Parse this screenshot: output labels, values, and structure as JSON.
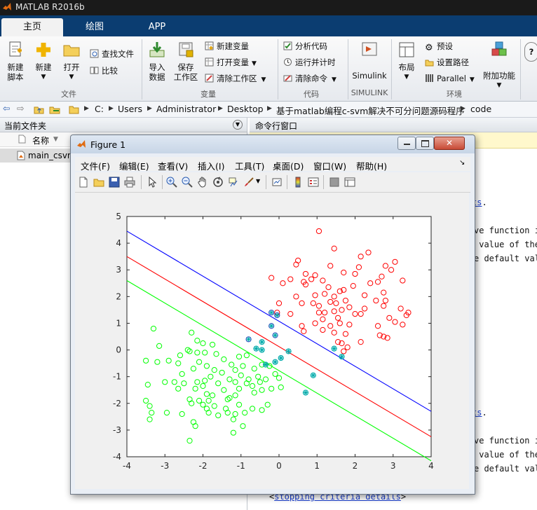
{
  "app": {
    "title": "MATLAB R2016b"
  },
  "ribbon_tabs": [
    {
      "label": "主页",
      "active": true
    },
    {
      "label": "绘图",
      "active": false
    },
    {
      "label": "APP",
      "active": false
    }
  ],
  "ribbon": {
    "file_group": "文件",
    "variable_group": "变量",
    "code_group": "代码",
    "simulink_group": "SIMULINK",
    "env_group": "环境",
    "new_script": "新建\n脚本",
    "new": "新建",
    "open": "打开",
    "find_files": "查找文件",
    "compare": "比较",
    "import_data": "导入\n数据",
    "save_workspace": "保存\n工作区",
    "new_variable": "新建变量",
    "open_variable": "打开变量",
    "clear_workspace": "清除工作区",
    "analyze_code": "分析代码",
    "run_and_time": "运行并计时",
    "clear_commands": "清除命令",
    "simulink": "Simulink",
    "layout": "布局",
    "preferences": "预设",
    "set_path": "设置路径",
    "parallel": "Parallel",
    "addons": "附加功能"
  },
  "address": {
    "crumbs": [
      "C:",
      "Users",
      "Administrator",
      "Desktop",
      "基于matlab编程c-svm解决不可分问题源码程序",
      "code"
    ]
  },
  "current_folder": {
    "title": "当前文件夹",
    "column_name": "名称",
    "files": [
      "main_csvm"
    ]
  },
  "command_window": {
    "title": "命令行窗口",
    "lines_top": [
      {
        "pre": "",
        "link": "ts",
        "post": "."
      },
      {
        "pre": "ve function i",
        "link": "",
        "post": ""
      },
      {
        "pre": " value of the",
        "link": "",
        "post": ""
      },
      {
        "pre": "e default val",
        "link": "",
        "post": ""
      }
    ],
    "lines_bottom": [
      {
        "pre": "",
        "link": "ts",
        "post": "."
      },
      {
        "pre": "ve function i",
        "link": "",
        "post": ""
      },
      {
        "pre": " value of the",
        "link": "",
        "post": ""
      },
      {
        "pre": "e default val",
        "link": "",
        "post": ""
      }
    ],
    "stop_open": "<",
    "stop_link": "stopping criteria details",
    "stop_close": ">"
  },
  "figure": {
    "title": "Figure 1",
    "menu": [
      "文件(F)",
      "编辑(E)",
      "查看(V)",
      "插入(I)",
      "工具(T)",
      "桌面(D)",
      "窗口(W)",
      "帮助(H)"
    ]
  },
  "colors": {
    "class_pos": "#ff0000",
    "class_neg": "#00ff00",
    "sv_marker": "#00aaaa",
    "boundary": "#ff0000",
    "margin_upper": "#0000ff",
    "margin_lower": "#00ff00"
  },
  "chart_data": {
    "type": "scatter",
    "title": "",
    "xlabel": "",
    "ylabel": "",
    "xlim": [
      -4,
      4
    ],
    "ylim": [
      -4,
      5
    ],
    "xticks": [
      -4,
      -3,
      -2,
      -1,
      0,
      1,
      2,
      3,
      4
    ],
    "yticks": [
      -4,
      -3,
      -2,
      -1,
      0,
      1,
      2,
      3,
      4,
      5
    ],
    "grid": false,
    "legend": "none",
    "lines": [
      {
        "role": "upper-margin",
        "color": "#0000ff",
        "x": [
          -4,
          4
        ],
        "y": [
          4.45,
          -2.3
        ]
      },
      {
        "role": "decision-boundary",
        "color": "#ff0000",
        "x": [
          -4,
          4
        ],
        "y": [
          3.5,
          -3.25
        ]
      },
      {
        "role": "lower-margin",
        "color": "#00ff00",
        "x": [
          -4,
          4
        ],
        "y": [
          2.6,
          -4.15
        ]
      }
    ],
    "series": [
      {
        "class": "positive",
        "marker": "o",
        "color": "#ff0000",
        "points": [
          [
            1.05,
            4.45
          ],
          [
            1.45,
            3.8
          ],
          [
            2.35,
            3.65
          ],
          [
            2.15,
            3.5
          ],
          [
            0.5,
            3.35
          ],
          [
            0.45,
            3.2
          ],
          [
            1.35,
            3.15
          ],
          [
            2.1,
            3.1
          ],
          [
            2.8,
            3.15
          ],
          [
            3.05,
            3.3
          ],
          [
            2.95,
            3.0
          ],
          [
            0.7,
            2.85
          ],
          [
            1.7,
            2.9
          ],
          [
            0.95,
            2.8
          ],
          [
            2.0,
            2.85
          ],
          [
            2.7,
            2.75
          ],
          [
            0.85,
            2.65
          ],
          [
            0.65,
            2.55
          ],
          [
            0.3,
            2.65
          ],
          [
            1.15,
            2.6
          ],
          [
            2.4,
            2.5
          ],
          [
            -0.2,
            2.7
          ],
          [
            0.1,
            2.5
          ],
          [
            0.7,
            2.45
          ],
          [
            1.3,
            2.35
          ],
          [
            1.95,
            2.4
          ],
          [
            2.6,
            2.55
          ],
          [
            3.25,
            2.6
          ],
          [
            1.2,
            2.1
          ],
          [
            1.6,
            2.2
          ],
          [
            1.7,
            2.25
          ],
          [
            2.25,
            2.05
          ],
          [
            2.75,
            2.15
          ],
          [
            0.45,
            2.0
          ],
          [
            0.95,
            2.05
          ],
          [
            1.45,
            2.0
          ],
          [
            0.0,
            1.75
          ],
          [
            0.6,
            1.75
          ],
          [
            0.9,
            1.75
          ],
          [
            1.35,
            1.8
          ],
          [
            1.5,
            1.75
          ],
          [
            1.75,
            1.85
          ],
          [
            2.55,
            1.85
          ],
          [
            2.8,
            1.85
          ],
          [
            -0.05,
            1.4
          ],
          [
            1.05,
            1.65
          ],
          [
            1.85,
            1.6
          ],
          [
            2.25,
            1.55
          ],
          [
            2.75,
            1.65
          ],
          [
            0.3,
            1.35
          ],
          [
            1.05,
            1.4
          ],
          [
            1.2,
            1.4
          ],
          [
            1.45,
            1.45
          ],
          [
            1.65,
            1.5
          ],
          [
            2.0,
            1.35
          ],
          [
            3.2,
            1.55
          ],
          [
            3.4,
            1.4
          ],
          [
            3.35,
            1.3
          ],
          [
            1.15,
            1.15
          ],
          [
            1.55,
            1.2
          ],
          [
            2.15,
            1.35
          ],
          [
            2.9,
            1.2
          ],
          [
            3.05,
            1.05
          ],
          [
            3.25,
            0.95
          ],
          [
            0.95,
            1.0
          ],
          [
            1.35,
            0.9
          ],
          [
            1.6,
            1.0
          ],
          [
            1.85,
            0.95
          ],
          [
            2.6,
            0.9
          ],
          [
            0.65,
            0.7
          ],
          [
            1.15,
            0.75
          ],
          [
            1.45,
            0.65
          ],
          [
            1.75,
            0.6
          ],
          [
            2.65,
            0.55
          ],
          [
            2.75,
            0.5
          ],
          [
            2.85,
            0.45
          ],
          [
            1.55,
            0.3
          ],
          [
            2.15,
            0.3
          ],
          [
            1.8,
            0.1
          ],
          [
            1.7,
            -0.05
          ],
          [
            0.6,
            0.9
          ],
          [
            1.65,
            0.25
          ]
        ]
      },
      {
        "class": "negative",
        "marker": "o",
        "color": "#00ff00",
        "points": [
          [
            -3.3,
            0.8
          ],
          [
            -2.3,
            0.65
          ],
          [
            -3.15,
            0.15
          ],
          [
            -2.15,
            0.35
          ],
          [
            -2.0,
            0.25
          ],
          [
            -1.75,
            0.2
          ],
          [
            -2.4,
            0.0
          ],
          [
            -2.35,
            -0.05
          ],
          [
            -2.15,
            -0.1
          ],
          [
            -1.95,
            -0.1
          ],
          [
            -1.65,
            -0.15
          ],
          [
            -1.45,
            -0.35
          ],
          [
            -1.05,
            -0.25
          ],
          [
            -0.85,
            -0.2
          ],
          [
            -2.6,
            -0.2
          ],
          [
            -2.9,
            -0.4
          ],
          [
            -3.2,
            -0.45
          ],
          [
            -3.5,
            -0.4
          ],
          [
            -2.65,
            -0.5
          ],
          [
            -2.1,
            -0.45
          ],
          [
            -1.9,
            -0.6
          ],
          [
            -1.7,
            -0.75
          ],
          [
            -1.25,
            -0.55
          ],
          [
            -1.15,
            -0.75
          ],
          [
            -0.95,
            -0.6
          ],
          [
            -0.65,
            -0.7
          ],
          [
            -0.45,
            -0.55
          ],
          [
            -0.25,
            -0.6
          ],
          [
            -2.25,
            -0.7
          ],
          [
            -2.55,
            -0.9
          ],
          [
            -1.5,
            -0.85
          ],
          [
            -1.0,
            -0.95
          ],
          [
            -0.55,
            -1.0
          ],
          [
            -0.1,
            -0.9
          ],
          [
            -1.8,
            -1.0
          ],
          [
            -1.3,
            -1.1
          ],
          [
            -0.8,
            -1.1
          ],
          [
            -0.35,
            -1.1
          ],
          [
            0.0,
            -1.05
          ],
          [
            -3.0,
            -1.2
          ],
          [
            -2.75,
            -1.2
          ],
          [
            -2.5,
            -1.25
          ],
          [
            -2.15,
            -1.2
          ],
          [
            -1.95,
            -1.15
          ],
          [
            -1.6,
            -1.25
          ],
          [
            -1.15,
            -1.2
          ],
          [
            -0.85,
            -1.25
          ],
          [
            -0.5,
            -1.2
          ],
          [
            -2.0,
            -1.35
          ],
          [
            -3.45,
            -1.3
          ],
          [
            -2.65,
            -1.45
          ],
          [
            -2.2,
            -1.45
          ],
          [
            -0.7,
            -1.35
          ],
          [
            -1.45,
            -1.5
          ],
          [
            -1.05,
            -1.45
          ],
          [
            -0.65,
            -1.6
          ],
          [
            -0.45,
            -1.5
          ],
          [
            -0.2,
            -1.45
          ],
          [
            -1.9,
            -1.65
          ],
          [
            -1.75,
            -1.7
          ],
          [
            -1.3,
            -1.8
          ],
          [
            -1.15,
            -1.7
          ],
          [
            0.05,
            -1.4
          ],
          [
            -2.35,
            -1.85
          ],
          [
            -2.1,
            -1.9
          ],
          [
            -1.85,
            -1.9
          ],
          [
            -1.35,
            -1.85
          ],
          [
            -3.5,
            -1.9
          ],
          [
            -2.0,
            -2.05
          ],
          [
            -1.7,
            -2.1
          ],
          [
            -1.9,
            -2.2
          ],
          [
            -3.4,
            -2.1
          ],
          [
            -2.3,
            -2.0
          ],
          [
            -1.05,
            -2.05
          ],
          [
            -0.7,
            -2.2
          ],
          [
            -0.45,
            -2.25
          ],
          [
            -0.3,
            -2.05
          ],
          [
            -3.35,
            -2.35
          ],
          [
            -2.95,
            -2.35
          ],
          [
            -2.55,
            -2.4
          ],
          [
            -1.85,
            -2.35
          ],
          [
            -1.4,
            -2.2
          ],
          [
            -1.35,
            -2.35
          ],
          [
            -1.15,
            -2.4
          ],
          [
            -3.4,
            -2.6
          ],
          [
            -2.25,
            -2.7
          ],
          [
            -2.2,
            -2.85
          ],
          [
            -1.2,
            -2.6
          ],
          [
            -0.95,
            -2.85
          ],
          [
            -1.2,
            -3.1
          ],
          [
            -0.9,
            -2.35
          ],
          [
            -2.35,
            -3.4
          ],
          [
            -1.6,
            -2.45
          ]
        ]
      },
      {
        "class": "support-vectors",
        "marker": "o+",
        "color": "#00aaaa",
        "points": [
          [
            -0.2,
            1.4
          ],
          [
            -0.2,
            0.9
          ],
          [
            -0.1,
            0.55
          ],
          [
            -0.8,
            0.4
          ],
          [
            -0.45,
            0.3
          ],
          [
            -0.6,
            0.05
          ],
          [
            -0.45,
            0.0
          ],
          [
            0.25,
            -0.05
          ],
          [
            0.05,
            -0.3
          ],
          [
            -0.1,
            -0.45
          ],
          [
            -0.35,
            -0.55
          ],
          [
            0.9,
            -0.95
          ],
          [
            0.7,
            -1.6
          ],
          [
            1.45,
            0.05
          ],
          [
            1.65,
            -0.25
          ],
          [
            -0.05,
            1.3
          ]
        ]
      }
    ]
  }
}
